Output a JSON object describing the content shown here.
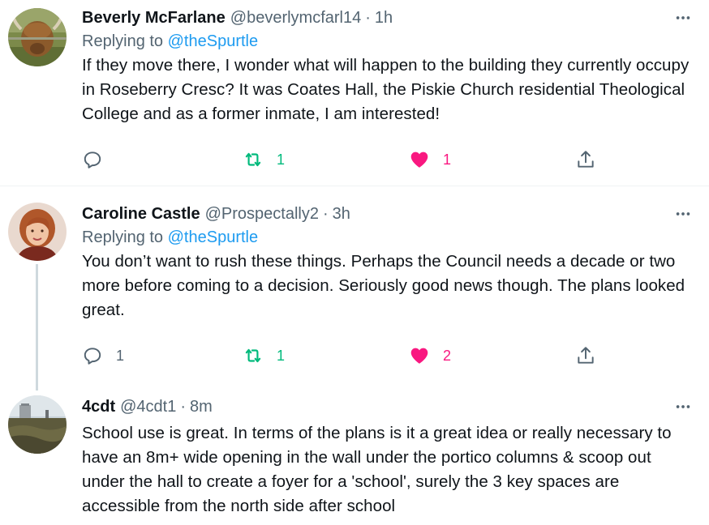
{
  "tweets": [
    {
      "name": "Beverly McFarlane",
      "handle": "@beverlymcfarl14",
      "time": "1h",
      "replying_label": "Replying to",
      "replying_to": "@theSpurtle",
      "text": "If they move there, I wonder what will happen to the building they currently occupy in Roseberry Cresc? It was Coates Hall, the Piskie Church residential Theological College and as a former inmate, I am interested!",
      "reply_count": "",
      "retweet_count": "1",
      "like_count": "1",
      "avatar": "highland-cow-avatar"
    },
    {
      "name": "Caroline Castle",
      "handle": "@Prospectally2",
      "time": "3h",
      "replying_label": "Replying to",
      "replying_to": "@theSpurtle",
      "text": "You don’t want to rush these things. Perhaps the Council needs a decade or two more before coming to a decision. Seriously good news though. The plans looked great.",
      "reply_count": "1",
      "retweet_count": "1",
      "like_count": "2",
      "avatar": "woman-portrait-avatar"
    },
    {
      "name": "4cdt",
      "handle": "@4cdt1",
      "time": "8m",
      "text": "School use is great. In terms of the plans is it a great idea or really necessary to have an 8m+ wide opening in the wall under the portico columns & scoop out under the hall to create a foyer for a 'school', surely the 3 key spaces are accessible from the north side after school",
      "avatar": "landscape-avatar"
    }
  ],
  "separator": "·",
  "icons": {
    "reply": "reply-icon",
    "retweet": "retweet-icon",
    "like": "heart-icon",
    "share": "share-icon",
    "more": "more-icon"
  },
  "colors": {
    "accent": "#1d9bf0",
    "retweet": "#00ba7c",
    "like": "#f91880",
    "secondary_text": "#536471"
  }
}
